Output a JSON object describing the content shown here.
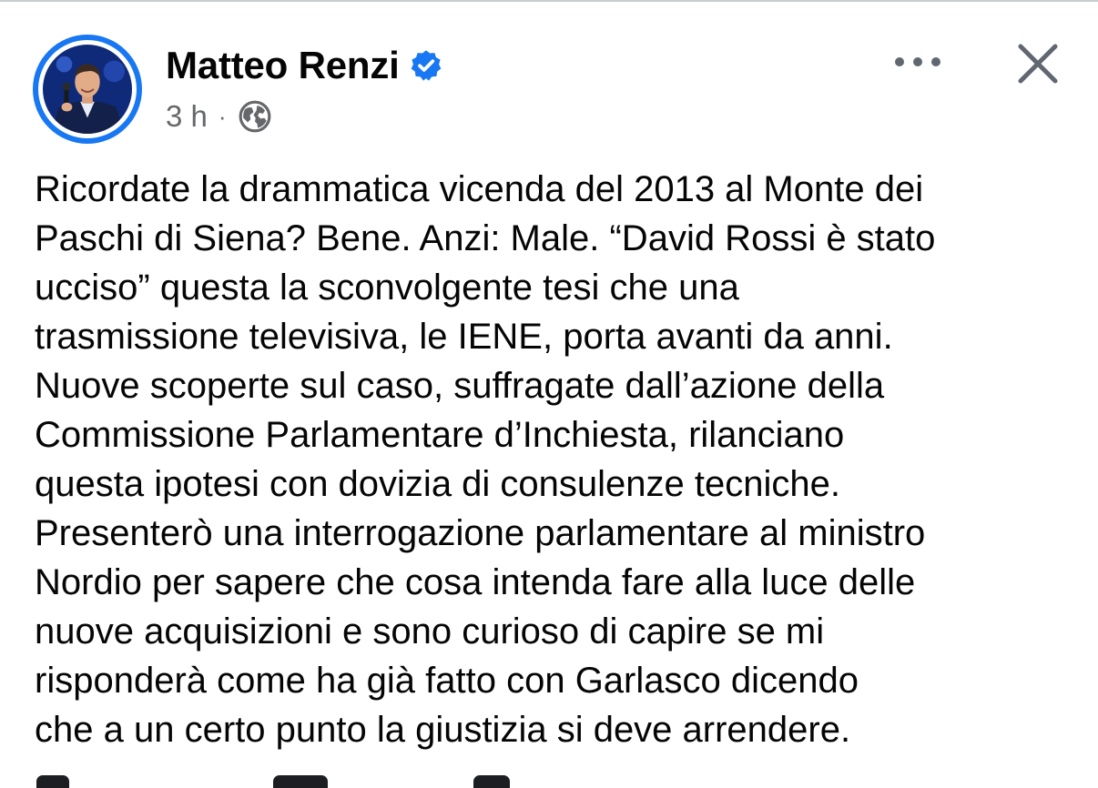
{
  "post": {
    "author": "Matteo Renzi",
    "verified": true,
    "time": "3 h",
    "separator": "·",
    "audience_icon": "globe-icon",
    "lines": [
      "Ricordate la drammatica vicenda del 2013 al Monte dei",
      "Paschi di Siena? Bene. Anzi: Male. “David Rossi è stato",
      "ucciso” questa la sconvolgente tesi che una",
      "trasmissione televisiva, le IENE, porta avanti da anni.",
      "Nuove scoperte sul caso, suffragate dall’azione della",
      "Commissione Parlamentare d’Inchiesta, rilanciano",
      "questa ipotesi con dovizia di consulenze tecniche.",
      "Presenterò una interrogazione parlamentare al ministro",
      "Nordio per sapere che cosa intenda fare alla luce delle",
      "nuove acquisizioni e sono curioso di capire se mi",
      "risponderà come ha già fatto con Garlasco dicendo",
      "che a un certo punto la giustizia si deve arrendere."
    ]
  },
  "controls": {
    "more_icon": "more-options-icon",
    "close_icon": "close-icon"
  },
  "colors": {
    "accent": "#1877f2",
    "text": "#050505",
    "secondary_text": "#65676b",
    "icon": "#606770"
  }
}
